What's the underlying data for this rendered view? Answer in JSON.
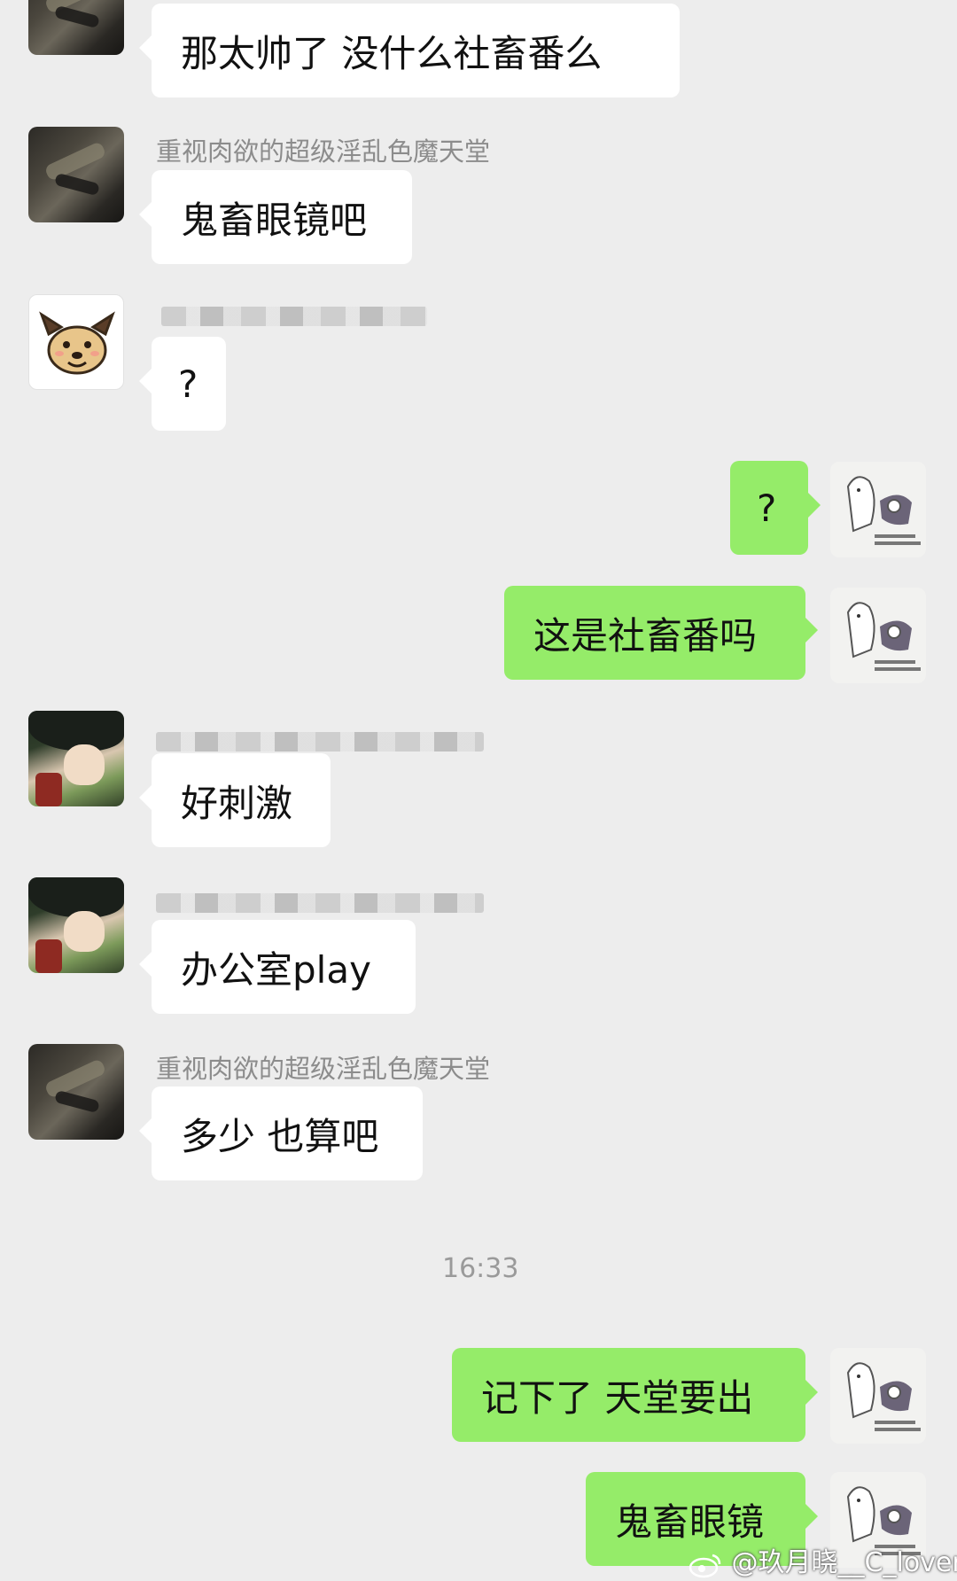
{
  "messages": [
    {
      "text": "那太帅了 没什么社畜番么"
    },
    {
      "sender": "重视肉欲的超级淫乱色魔天堂",
      "text": "鬼畜眼镜吧"
    },
    {
      "text": "?"
    },
    {
      "text": "?"
    },
    {
      "text": "这是社畜番吗"
    },
    {
      "text": "好刺激"
    },
    {
      "text": "办公室play"
    },
    {
      "sender": "重视肉欲的超级淫乱色魔天堂",
      "text": "多少 也算吧"
    },
    {
      "text": "记下了 天堂要出"
    },
    {
      "text": "鬼畜眼镜"
    }
  ],
  "timestamp": "16:33",
  "watermark": "@玖月晓__C_lover",
  "colors": {
    "background": "#ededed",
    "incoming": "#ffffff",
    "outgoing": "#95ec69"
  },
  "icons": {
    "watermark_logo": "weibo-icon",
    "sticker_avatar": "ghost-sticker-avatar"
  }
}
